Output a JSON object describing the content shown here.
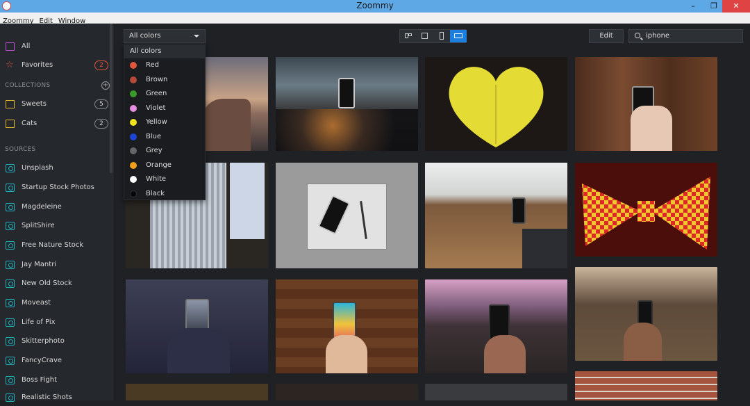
{
  "window": {
    "title": "Zoommy",
    "controls": [
      "minimize",
      "restore",
      "close"
    ]
  },
  "menu": [
    "Zoommy",
    "Edit",
    "Window"
  ],
  "sidebar": {
    "all_label": "All",
    "favorites": {
      "label": "Favorites",
      "count": "2"
    },
    "collections_header": "COLLECTIONS",
    "collections": [
      {
        "label": "Sweets",
        "count": "5"
      },
      {
        "label": "Cats",
        "count": "2"
      }
    ],
    "sources_header": "SOURCES",
    "sources": [
      "Unsplash",
      "Startup Stock Photos",
      "Magdeleine",
      "SplitShire",
      "Free Nature Stock",
      "Jay Mantri",
      "New Old Stock",
      "Moveast",
      "Life of Pix",
      "Skitterphoto",
      "FancyCrave",
      "Boss Fight",
      "Realistic Shots"
    ]
  },
  "toolbar": {
    "color_filter": "All colors",
    "edit_label": "Edit",
    "search_value": "iphone",
    "view_modes": [
      "grid-view",
      "single-view",
      "portrait-view",
      "landscape-view"
    ],
    "active_view": "landscape-view"
  },
  "color_dropdown": {
    "header": "All colors",
    "options": [
      {
        "label": "Red",
        "color": "#e0553b"
      },
      {
        "label": "Brown",
        "color": "#b5483a"
      },
      {
        "label": "Green",
        "color": "#3a9a2c"
      },
      {
        "label": "Violet",
        "color": "#e58de0"
      },
      {
        "label": "Yellow",
        "color": "#f0e21a"
      },
      {
        "label": "Blue",
        "color": "#1c44d8"
      },
      {
        "label": "Grey",
        "color": "#666666"
      },
      {
        "label": "Orange",
        "color": "#f0a01a"
      },
      {
        "label": "White",
        "color": "#ffffff"
      },
      {
        "label": "Black",
        "color": "#050505"
      }
    ]
  },
  "colors": {
    "accent": "#1c7fe0",
    "source_icon": "#22b3bf",
    "folder_icon": "#e3b62c",
    "favorite_icon": "#e0553b"
  }
}
